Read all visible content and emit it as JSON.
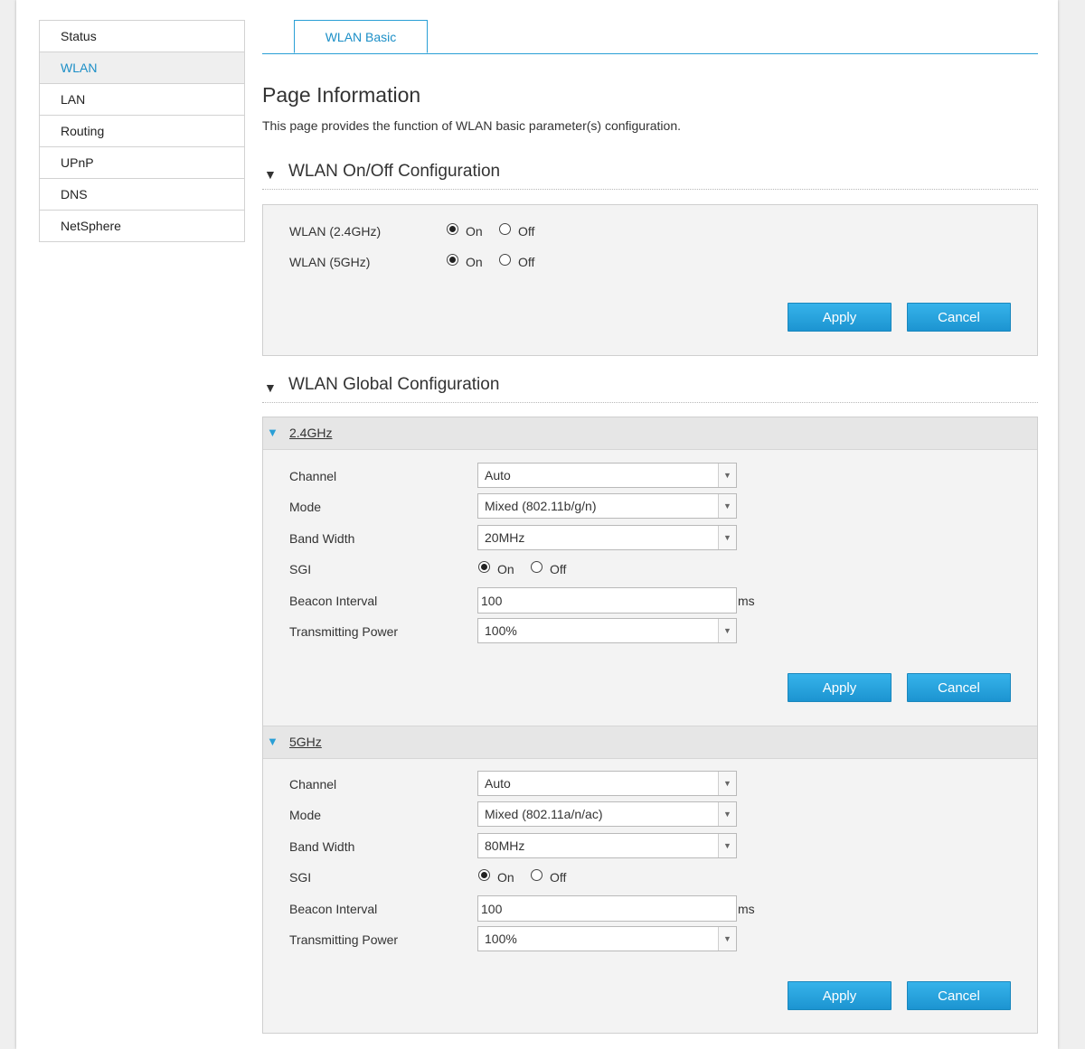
{
  "sidebar": {
    "items": [
      {
        "label": "Status"
      },
      {
        "label": "WLAN"
      },
      {
        "label": "LAN"
      },
      {
        "label": "Routing"
      },
      {
        "label": "UPnP"
      },
      {
        "label": "DNS"
      },
      {
        "label": "NetSphere"
      }
    ],
    "active": "WLAN"
  },
  "tabs": [
    {
      "label": "WLAN Basic"
    }
  ],
  "page": {
    "title": "Page Information",
    "description": "This page provides the function of WLAN basic parameter(s) configuration."
  },
  "onoff_section": {
    "title": "WLAN On/Off Configuration",
    "rows": [
      {
        "label": "WLAN (2.4GHz)",
        "on_label": "On",
        "off_label": "Off",
        "value": "On"
      },
      {
        "label": "WLAN (5GHz)",
        "on_label": "On",
        "off_label": "Off",
        "value": "On"
      }
    ],
    "apply_label": "Apply",
    "cancel_label": "Cancel"
  },
  "global_section": {
    "title": "WLAN Global Configuration",
    "bands": [
      {
        "name": "2.4GHz",
        "channel_label": "Channel",
        "channel": "Auto",
        "mode_label": "Mode",
        "mode": "Mixed (802.11b/g/n)",
        "bandwidth_label": "Band Width",
        "bandwidth": "20MHz",
        "sgi_label": "SGI",
        "sgi_on_label": "On",
        "sgi_off_label": "Off",
        "sgi": "On",
        "beacon_label": "Beacon Interval",
        "beacon": "100",
        "beacon_unit": "ms",
        "power_label": "Transmitting Power",
        "power": "100%",
        "apply_label": "Apply",
        "cancel_label": "Cancel"
      },
      {
        "name": "5GHz",
        "channel_label": "Channel",
        "channel": "Auto",
        "mode_label": "Mode",
        "mode": "Mixed (802.11a/n/ac)",
        "bandwidth_label": "Band Width",
        "bandwidth": "80MHz",
        "sgi_label": "SGI",
        "sgi_on_label": "On",
        "sgi_off_label": "Off",
        "sgi": "On",
        "beacon_label": "Beacon Interval",
        "beacon": "100",
        "beacon_unit": "ms",
        "power_label": "Transmitting Power",
        "power": "100%",
        "apply_label": "Apply",
        "cancel_label": "Cancel"
      }
    ]
  },
  "icons": {
    "section_toggle": "triangle-down-icon",
    "band_toggle": "triangle-down-blue-icon",
    "select_arrow": "chevron-down-icon"
  },
  "colors": {
    "accent": "#2a9fd6",
    "button": "#1c94d1",
    "active_text": "#1c8fc7"
  }
}
